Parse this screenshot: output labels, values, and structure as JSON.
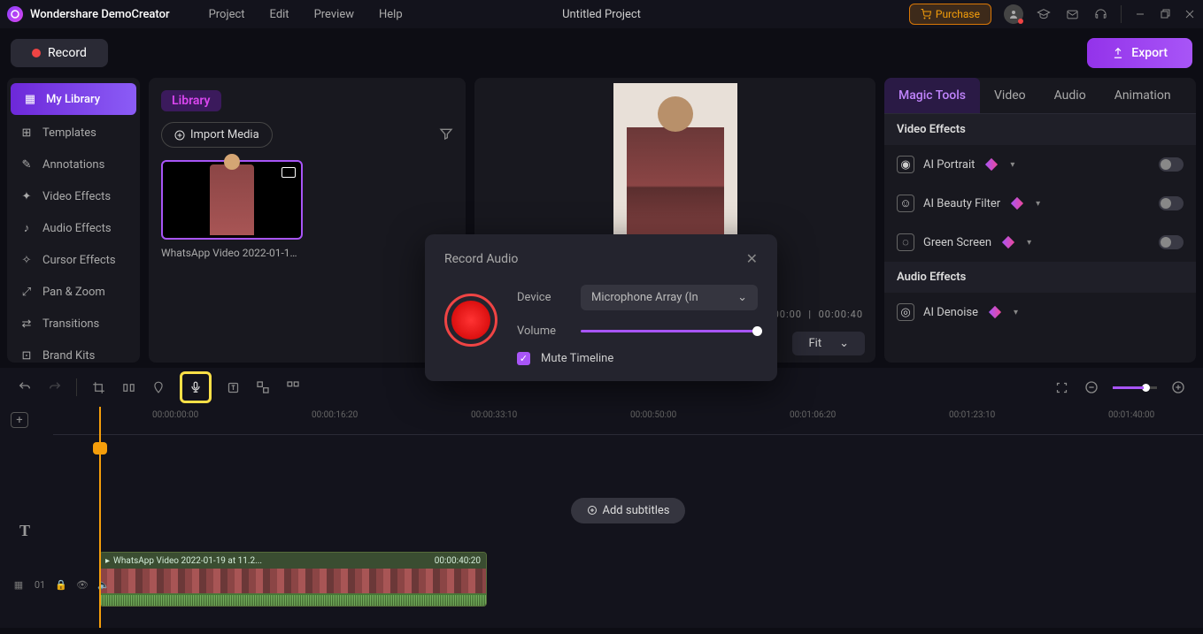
{
  "app": {
    "brand": "Wondershare DemoCreator",
    "projectTitle": "Untitled Project"
  },
  "menu": [
    "Project",
    "Edit",
    "Preview",
    "Help"
  ],
  "purchase": "Purchase",
  "recordBtn": "Record",
  "exportBtn": "Export",
  "sidebar": [
    {
      "label": "My Library",
      "active": true
    },
    {
      "label": "Templates"
    },
    {
      "label": "Annotations"
    },
    {
      "label": "Video Effects"
    },
    {
      "label": "Audio Effects"
    },
    {
      "label": "Cursor Effects"
    },
    {
      "label": "Pan & Zoom"
    },
    {
      "label": "Transitions"
    },
    {
      "label": "Brand Kits"
    }
  ],
  "library": {
    "title": "Library",
    "importBtn": "Import Media",
    "clipName": "WhatsApp Video 2022-01-19 ..."
  },
  "preview": {
    "time": "00:00:00",
    "duration": "00:00:40",
    "fit": "Fit"
  },
  "propsTabs": [
    "Magic Tools",
    "Video",
    "Audio",
    "Animation"
  ],
  "props": {
    "section1": "Video Effects",
    "items1": [
      "AI Portrait",
      "AI Beauty Filter",
      "Green Screen"
    ],
    "section2": "Audio Effects",
    "items2": [
      "AI Denoise"
    ]
  },
  "dialog": {
    "title": "Record Audio",
    "deviceLabel": "Device",
    "deviceValue": "Microphone Array (In",
    "volumeLabel": "Volume",
    "muteLabel": "Mute Timeline"
  },
  "ruler": [
    "00:00:00:00",
    "00:00:16:20",
    "00:00:33:10",
    "00:00:50:00",
    "00:01:06:20",
    "00:01:23:10",
    "00:01:40:00"
  ],
  "addSubtitles": "Add subtitles",
  "clip": {
    "name": "WhatsApp Video 2022-01-19 at 11.2...",
    "dur": "00:00:40:20"
  },
  "trackCount": "01"
}
